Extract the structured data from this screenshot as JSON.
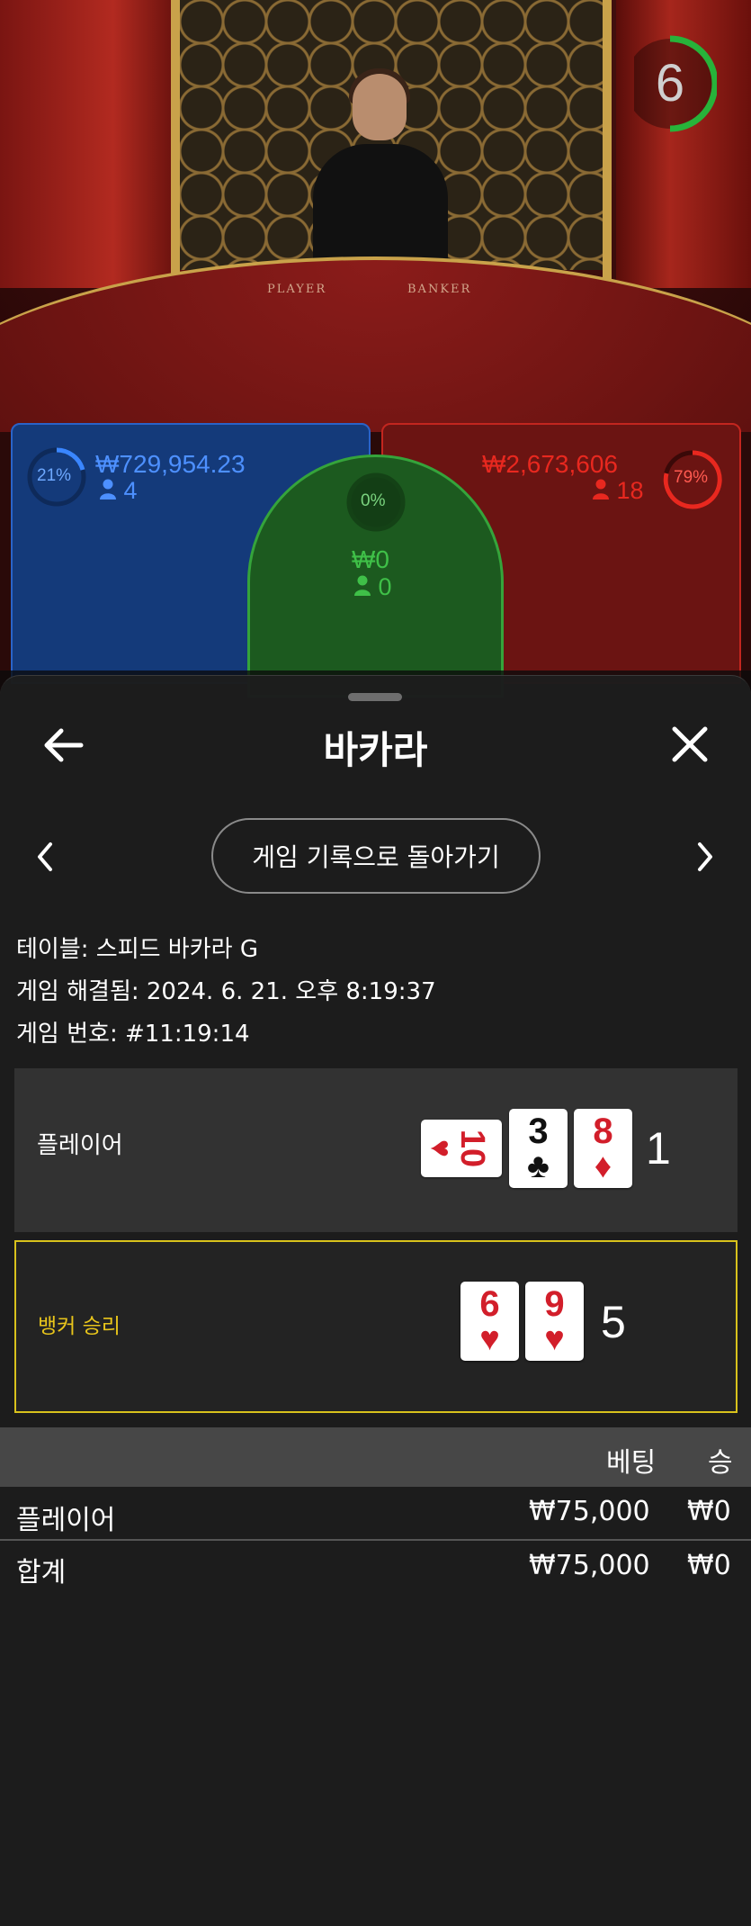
{
  "game": {
    "timer": "6",
    "felt_labels": {
      "player": "PLAYER",
      "banker": "BANKER"
    },
    "player_bet": {
      "percent": "21%",
      "amount": "₩729,954.23",
      "count": "4"
    },
    "banker_bet": {
      "percent": "79%",
      "amount": "₩2,673,606",
      "count": "18"
    },
    "tie_bet": {
      "percent": "0%",
      "amount": "₩0",
      "count": "0"
    }
  },
  "modal": {
    "title": "바카라",
    "back_to_history": "게임 기록으로 돌아가기",
    "table_line": "테이블: 스피드 바카라 G",
    "resolved_line": "게임 해결됨: 2024. 6. 21. 오후 8:19:37",
    "game_number_line": "게임 번호: #11:19:14",
    "player_row": {
      "label": "플레이어",
      "cards": [
        {
          "rank": "10",
          "suit": "♥",
          "color": "red"
        },
        {
          "rank": "3",
          "suit": "♣",
          "color": "black"
        },
        {
          "rank": "8",
          "suit": "♦",
          "color": "red"
        }
      ],
      "score": "1"
    },
    "banker_row": {
      "label": "뱅커 승리",
      "label_color": "#e8c51b",
      "cards": [
        {
          "rank": "6",
          "suit": "♥",
          "color": "red"
        },
        {
          "rank": "9",
          "suit": "♥",
          "color": "red"
        }
      ],
      "score": "5"
    },
    "bets_table": {
      "headers": {
        "bet": "베팅",
        "win": "승"
      },
      "rows": [
        {
          "label": "플레이어",
          "bet": "₩75,000",
          "win": "₩0"
        },
        {
          "label": "합계",
          "bet": "₩75,000",
          "win": "₩0"
        }
      ]
    }
  },
  "colors": {
    "player_blue": "#2a63c8",
    "banker_red": "#c3261f",
    "tie_green": "#35a43b",
    "win_border": "#d8c21c"
  }
}
